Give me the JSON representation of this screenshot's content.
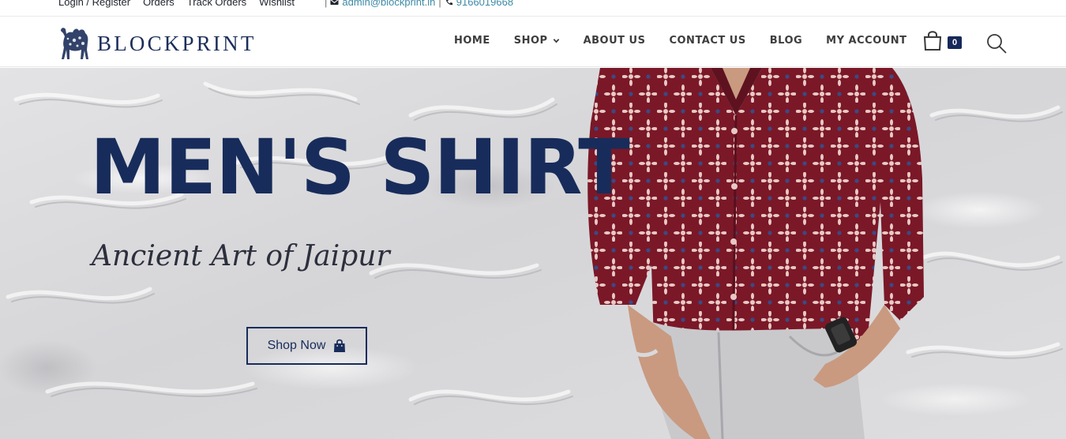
{
  "topbar": {
    "links": [
      "Login / Register",
      "Orders",
      "Track Orders",
      "Wishlist"
    ],
    "email": "admin@blockprint.in",
    "phone": "9166019668",
    "separator": "|"
  },
  "header": {
    "logo_text": "BLOCKPRINT",
    "nav": [
      {
        "label": "HOME"
      },
      {
        "label": "SHOP"
      },
      {
        "label": "ABOUT US"
      },
      {
        "label": "CONTACT US"
      },
      {
        "label": "BLOG"
      },
      {
        "label": "MY ACCOUNT"
      }
    ],
    "cart_count": "0",
    "icons": {
      "cart": "shopping-bag-icon",
      "search": "search-icon",
      "shop_dropdown": "chevron-down-icon"
    }
  },
  "hero": {
    "title": "MEN'S SHIRT",
    "subtitle": "Ancient Art of Jaipur",
    "button_label": "Shop Now",
    "button_icon": "bag-icon"
  },
  "colors": {
    "brand_navy": "#182c5b",
    "link_teal": "#3d8aa6",
    "shirt_maroon": "#7a1828",
    "pants_grey": "#c9c9cc"
  }
}
